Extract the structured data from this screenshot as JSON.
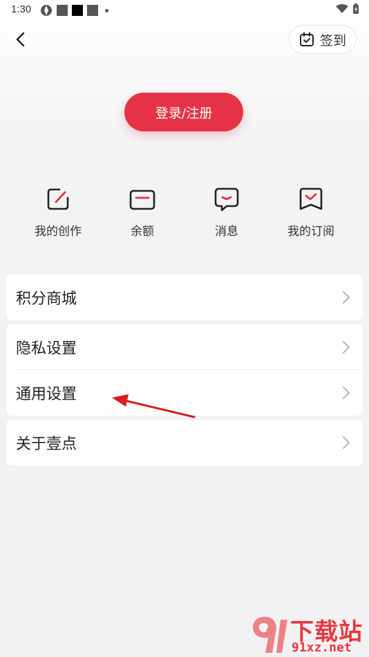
{
  "status_bar": {
    "time": "1:30"
  },
  "header": {
    "back_icon": "chevron-left-icon",
    "checkin_icon": "calendar-check-icon",
    "checkin_label": "签到"
  },
  "login": {
    "label": "登录/注册"
  },
  "quick_actions": [
    {
      "label": "我的创作",
      "icon": "edit-icon"
    },
    {
      "label": "余额",
      "icon": "wallet-icon"
    },
    {
      "label": "消息",
      "icon": "message-icon"
    },
    {
      "label": "我的订阅",
      "icon": "subscription-icon"
    }
  ],
  "menu": {
    "card1": [
      {
        "label": "积分商城"
      }
    ],
    "card2": [
      {
        "label": "隐私设置"
      },
      {
        "label": "通用设置"
      }
    ],
    "card3": [
      {
        "label": "关于壹点"
      }
    ]
  },
  "watermark": {
    "title": "下载站",
    "url": "91xz.net"
  },
  "colors": {
    "accent": "#e63246",
    "icon_dark": "#222222",
    "annotation": "#d81e1e"
  }
}
